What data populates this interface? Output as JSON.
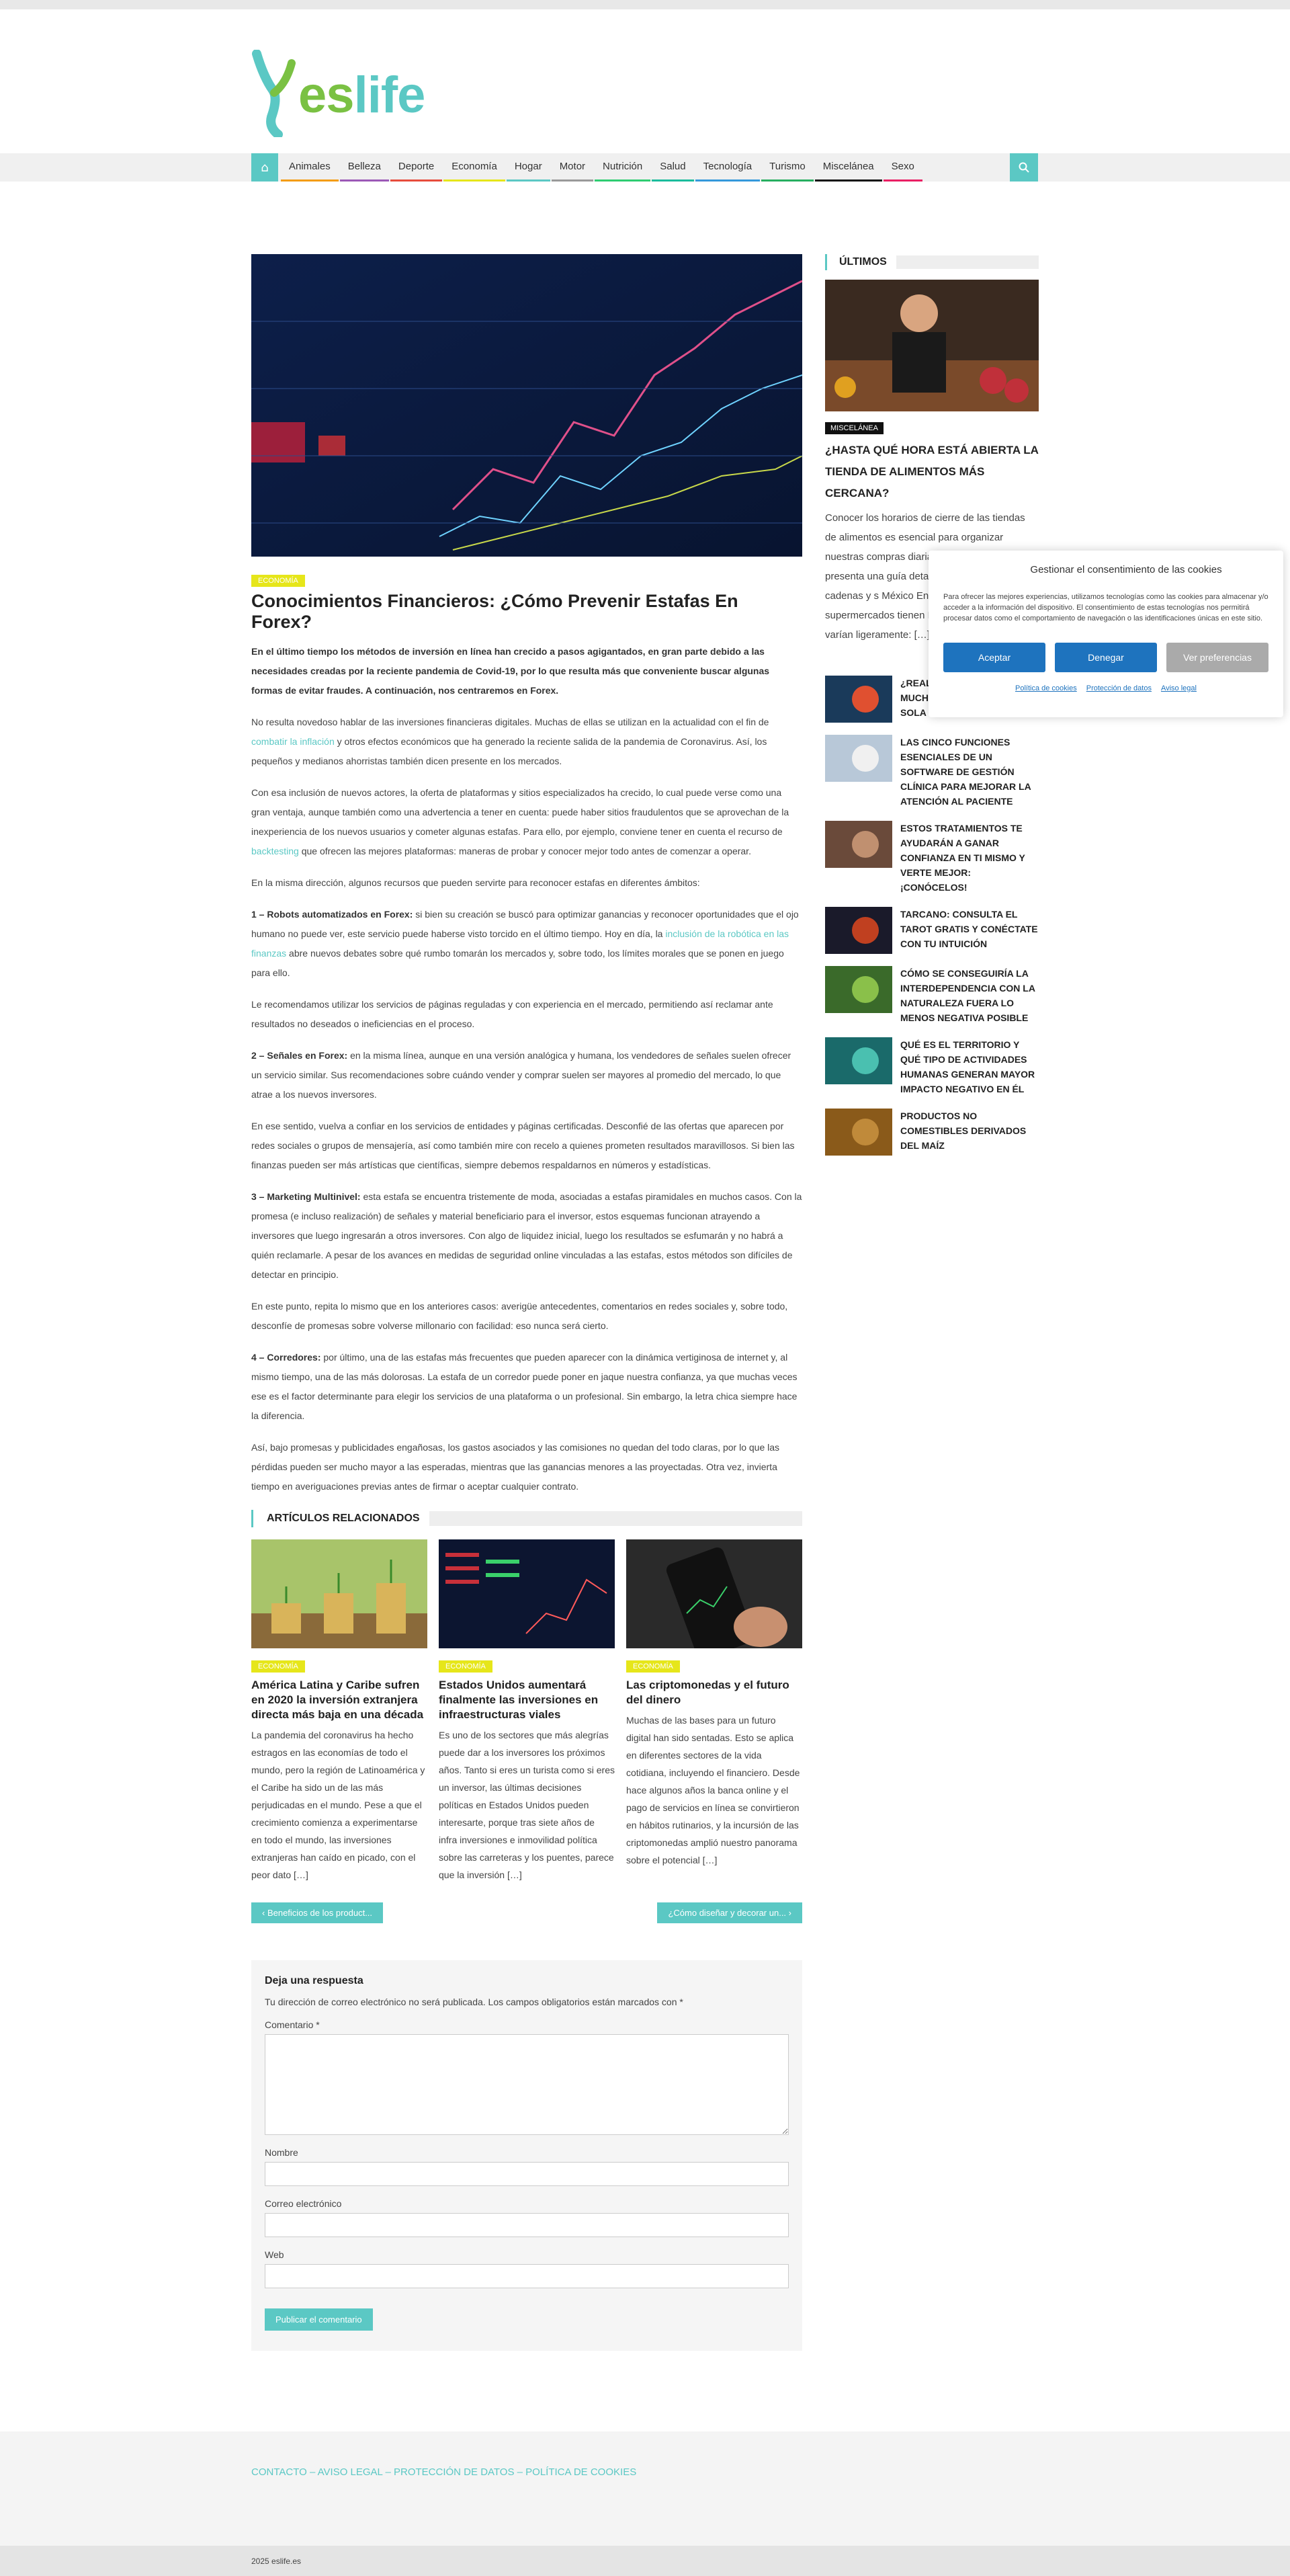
{
  "site": {
    "name": "eslife",
    "logo_letters": [
      "e",
      "s",
      "l",
      "i",
      "f",
      "e"
    ]
  },
  "nav": {
    "items": [
      {
        "label": "Animales",
        "color": "#f39c12"
      },
      {
        "label": "Belleza",
        "color": "#9b59b6"
      },
      {
        "label": "Deporte",
        "color": "#e74c3c"
      },
      {
        "label": "Economía",
        "color": "#e6e61a"
      },
      {
        "label": "Hogar",
        "color": "#5bc8c4"
      },
      {
        "label": "Motor",
        "color": "#999999"
      },
      {
        "label": "Nutrición",
        "color": "#2ecc71"
      },
      {
        "label": "Salud",
        "color": "#1abc9c"
      },
      {
        "label": "Tecnología",
        "color": "#3498db"
      },
      {
        "label": "Turismo",
        "color": "#27ae60"
      },
      {
        "label": "Miscelánea",
        "color": "#111111"
      },
      {
        "label": "Sexo",
        "color": "#e91e63"
      }
    ]
  },
  "post": {
    "category": "ECONOMÍA",
    "title": "Conocimientos Financieros: ¿Cómo Prevenir Estafas En Forex?",
    "lead": "En el último tiempo los métodos de inversión en línea han crecido a pasos agigantados, en gran parte debido a las necesidades creadas por la reciente pandemia de Covid-19, por lo que resulta más que conveniente buscar algunas formas de evitar fraudes. A continuación, nos centraremos en Forex.",
    "p1a": "No resulta novedoso hablar de las inversiones financieras digitales. Muchas de ellas se utilizan en la actualidad con el fin de ",
    "p1link": "combatir la inflación",
    "p1b": " y otros efectos económicos que ha generado la reciente salida de la pandemia de Coronavirus. Así, los pequeños y medianos ahorristas también dicen presente en los mercados.",
    "p2a": "Con esa inclusión de nuevos actores, la oferta de plataformas y sitios especializados ha crecido, lo cual puede verse como una gran ventaja, aunque también como una advertencia a tener en cuenta: puede haber sitios fraudulentos que se aprovechan de la inexperiencia de los nuevos usuarios y cometer algunas estafas. Para ello, por ejemplo, conviene tener en cuenta el recurso de ",
    "p2link": "backtesting",
    "p2b": " que ofrecen las mejores plataformas: maneras de probar y conocer mejor todo antes de comenzar a operar.",
    "p3": "En la misma dirección, algunos recursos que pueden servirte para reconocer estafas en diferentes ámbitos:",
    "p4bold": "1 – Robots automatizados en Forex:",
    "p4a": " si bien su creación se buscó para optimizar ganancias y reconocer oportunidades que el ojo humano no puede ver, este servicio puede haberse visto torcido en el último tiempo. Hoy en día, la ",
    "p4link": "inclusión de la robótica en las finanzas",
    "p4b": " abre nuevos debates sobre qué rumbo tomarán los mercados y, sobre todo, los límites morales que se ponen en juego para ello.",
    "p5": "Le recomendamos utilizar los servicios de páginas reguladas y con experiencia en el mercado, permitiendo así reclamar ante resultados no deseados o ineficiencias en el proceso.",
    "p6bold": "2 – Señales en Forex:",
    "p6": " en la misma línea, aunque en una versión analógica y humana, los vendedores de señales suelen ofrecer un servicio similar. Sus recomendaciones sobre cuándo vender y comprar suelen ser mayores al promedio del mercado, lo que atrae a los nuevos inversores.",
    "p7": "En ese sentido, vuelva a confiar en los servicios de entidades y páginas certificadas. Desconfié de las ofertas que aparecen por redes sociales o grupos de mensajería, así como también mire con recelo a quienes prometen resultados maravillosos. Si bien las finanzas pueden ser más artísticas que científicas, siempre debemos respaldarnos en números y estadísticas.",
    "p8bold": "3 – Marketing Multinivel:",
    "p8": " esta estafa se encuentra tristemente de moda, asociadas a estafas piramidales en muchos casos. Con la promesa (e incluso realización) de señales y material beneficiario para el inversor, estos esquemas funcionan atrayendo a inversores que luego ingresarán a otros inversores. Con algo de liquidez inicial, luego los resultados se esfumarán y no habrá a quién reclamarle. A pesar de los avances en medidas de seguridad online vinculadas a las estafas, estos métodos son difíciles de detectar en principio.",
    "p9": "En este punto, repita lo mismo que en los anteriores casos: averigüe antecedentes, comentarios en redes sociales y, sobre todo, desconfíe de promesas sobre volverse millonario con facilidad: eso nunca será cierto.",
    "p10bold": "4 – Corredores:",
    "p10": " por último, una de las estafas más frecuentes que pueden aparecer con la dinámica vertiginosa de internet y, al mismo tiempo, una de las más dolorosas. La estafa de un corredor puede poner en jaque nuestra confianza, ya que muchas veces ese es el factor determinante para elegir los servicios de una plataforma o un profesional. Sin embargo, la letra chica siempre hace la diferencia.",
    "p11": "Así, bajo promesas y publicidades engañosas, los gastos asociados y las comisiones no quedan del todo claras, por lo que las pérdidas pueden ser mucho mayor a las esperadas, mientras que las ganancias menores a las proyectadas. Otra vez, invierta tiempo en averiguaciones previas antes de firmar o aceptar cualquier contrato."
  },
  "related": {
    "heading": "ARTÍCULOS RELACIONADOS",
    "items": [
      {
        "category": "ECONOMÍA",
        "title": "América Latina y Caribe sufren en 2020 la inversión extranjera directa más baja en una década",
        "excerpt": "La pandemia del coronavirus ha hecho estragos en las economías de todo el mundo, pero la región de Latinoamérica y el Caribe ha sido un de las más perjudicadas en el mundo. Pese a que el crecimiento comienza a experimentarse en todo el mundo, las inversiones extranjeras han caído en picado, con el peor dato […]"
      },
      {
        "category": "ECONOMÍA",
        "title": "Estados Unidos aumentará finalmente las inversiones en infraestructuras viales",
        "excerpt": "Es uno de los sectores que más alegrías puede dar a los inversores los próximos años. Tanto si eres un turista como si eres un inversor, las últimas decisiones políticas en Estados Unidos pueden interesarte, porque tras siete años de infra inversiones e inmovilidad política sobre las carreteras y los puentes, parece que la inversión […]"
      },
      {
        "category": "ECONOMÍA",
        "title": "Las criptomonedas y el futuro del dinero",
        "excerpt": "Muchas de las bases para un futuro digital han sido sentadas. Esto se aplica en diferentes sectores de la vida cotidiana, incluyendo el financiero. Desde hace algunos años la banca online y el pago de servicios en línea se convirtieron en hábitos rutinarios, y la incursión de las criptomonedas amplió nuestro panorama sobre el potencial […]"
      }
    ]
  },
  "postnav": {
    "prev": "‹ Beneficios de los product...",
    "next": "¿Cómo diseñar y decorar un... ›"
  },
  "comments": {
    "title": "Deja una respuesta",
    "note": "Tu dirección de correo electrónico no será publicada. Los campos obligatorios están marcados con *",
    "comment_label": "Comentario *",
    "name_label": "Nombre",
    "email_label": "Correo electrónico",
    "web_label": "Web",
    "submit": "Publicar el comentario"
  },
  "sidebar": {
    "heading": "ÚLTIMOS",
    "featured": {
      "category": "MISCELÁNEA",
      "title": "¿Hasta qué hora está abierta la tienda de alimentos más cercana?",
      "excerpt": "Conocer los horarios de cierre de las tiendas de alimentos es esencial para organizar nuestras compras diarias. A continuación, se presenta una guía detallada por p principales cadenas y s México En México, las p supermercados tienen En Perú, los horarios de varían ligeramente: […]"
    },
    "items": [
      {
        "title": "¿Real... casinos online? Mucho humo y ni una sola ruleta"
      },
      {
        "title": "Las cinco funciones esenciales de un software de gestión clínica para mejorar la atención al paciente"
      },
      {
        "title": "Estos tratamientos te ayudarán a ganar confianza en ti mismo y verte mejor: ¡conócelos!"
      },
      {
        "title": "Tarcano: consulta el tarot gratis y conéctate con tu intuición"
      },
      {
        "title": "Cómo se conseguiría la interdependencia con la naturaleza fuera lo menos negativa posible"
      },
      {
        "title": "Qué es el territorio y qué tipo de actividades humanas generan mayor impacto negativo en él"
      },
      {
        "title": "Productos no comestibles derivados del maíz"
      }
    ]
  },
  "cookie": {
    "title": "Gestionar el consentimiento de las cookies",
    "text": "Para ofrecer las mejores experiencias, utilizamos tecnologías como las cookies para almacenar y/o acceder a la información del dispositivo. El consentimiento de estas tecnologías nos permitirá procesar datos como el comportamiento de navegación o las identificaciones únicas en este sitio.",
    "accept": "Aceptar",
    "deny": "Denegar",
    "prefs": "Ver preferencias",
    "links": [
      "Política de cookies",
      "Protección de datos",
      "Aviso legal"
    ]
  },
  "footer": {
    "links": "CONTACTO – AVISO LEGAL – PROTECCIÓN DE DATOS – POLÍTICA DE COOKIES",
    "copyright": "2025 eslife.es"
  },
  "colors": {
    "accent": "#5bc8c4",
    "economia": "#e6e61a",
    "logo_green": "#7ac143",
    "logo_blue": "#5bc8c4"
  }
}
